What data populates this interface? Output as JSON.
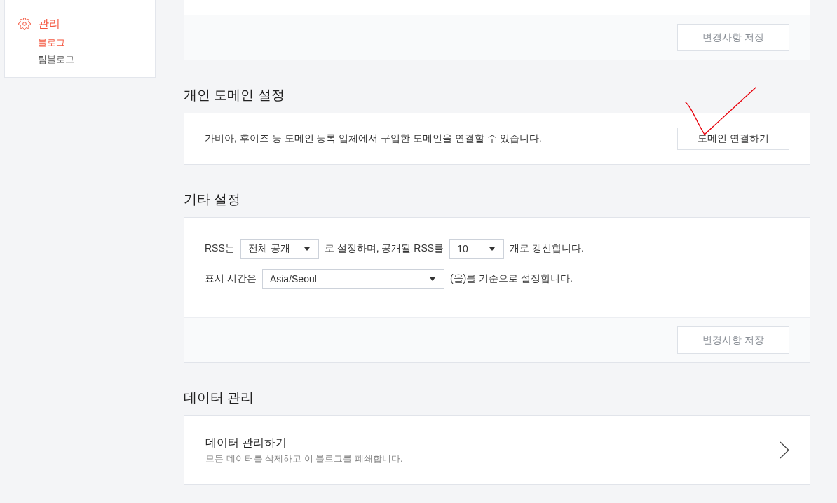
{
  "sidebar": {
    "group": {
      "label": "관리",
      "active": true
    },
    "items": [
      {
        "label": "블로그",
        "selected": true
      },
      {
        "label": "팀블로그",
        "selected": false
      }
    ]
  },
  "sections": [
    {
      "kind": "form",
      "footer_button": {
        "label": "변경사항 저장",
        "disabled": true
      }
    },
    {
      "kind": "action",
      "title": "개인 도메인 설정",
      "description": "가비아, 후이즈 등 도메인 등록 업체에서 구입한 도메인을 연결할 수 있습니다.",
      "button": {
        "label": "도메인 연결하기",
        "disabled": false
      }
    },
    {
      "kind": "form",
      "title": "기타 설정",
      "rows": [
        {
          "parts": [
            {
              "kind": "text",
              "text": "RSS는"
            },
            {
              "kind": "select",
              "value": "전체 공개"
            },
            {
              "kind": "text",
              "text": "로 설정하며, 공개될 RSS를"
            },
            {
              "kind": "select",
              "value": "10"
            },
            {
              "kind": "text",
              "text": "개로 갱신합니다."
            }
          ]
        },
        {
          "parts": [
            {
              "kind": "text",
              "text": "표시 시간은"
            },
            {
              "kind": "select",
              "value": "Asia/Seoul"
            },
            {
              "kind": "text",
              "text": "(을)를 기준으로 설정합니다."
            }
          ]
        }
      ],
      "footer_button": {
        "label": "변경사항 저장",
        "disabled": true
      }
    },
    {
      "kind": "link",
      "title": "데이터 관리",
      "link": {
        "title": "데이터 관리하기",
        "description": "모든 데이터를 삭제하고 이 블로그를 폐쇄합니다."
      }
    }
  ]
}
